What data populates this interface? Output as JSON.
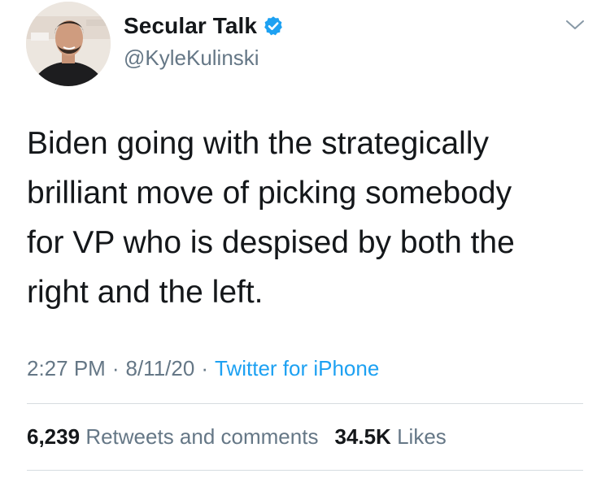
{
  "account": {
    "display_name": "Secular Talk",
    "handle": "@KyleKulinski",
    "verified": true,
    "avatar_icon": "profile-photo"
  },
  "tweet": {
    "text": "Biden going with the strategically\nbrilliant move of picking somebody\nfor VP who is despised by both the\nright and the left.",
    "time": "2:27 PM",
    "date": "8/11/20",
    "source": "Twitter for iPhone",
    "separator": "·"
  },
  "stats": {
    "retweets_count": "6,239",
    "retweets_label": "Retweets and comments",
    "likes_count": "34.5K",
    "likes_label": "Likes"
  },
  "colors": {
    "text": "#14171a",
    "secondary": "#657786",
    "accent": "#1da1f2",
    "divider": "#d6dce0"
  },
  "icons": {
    "verified": "verified-badge-icon",
    "menu": "chevron-down-icon"
  }
}
